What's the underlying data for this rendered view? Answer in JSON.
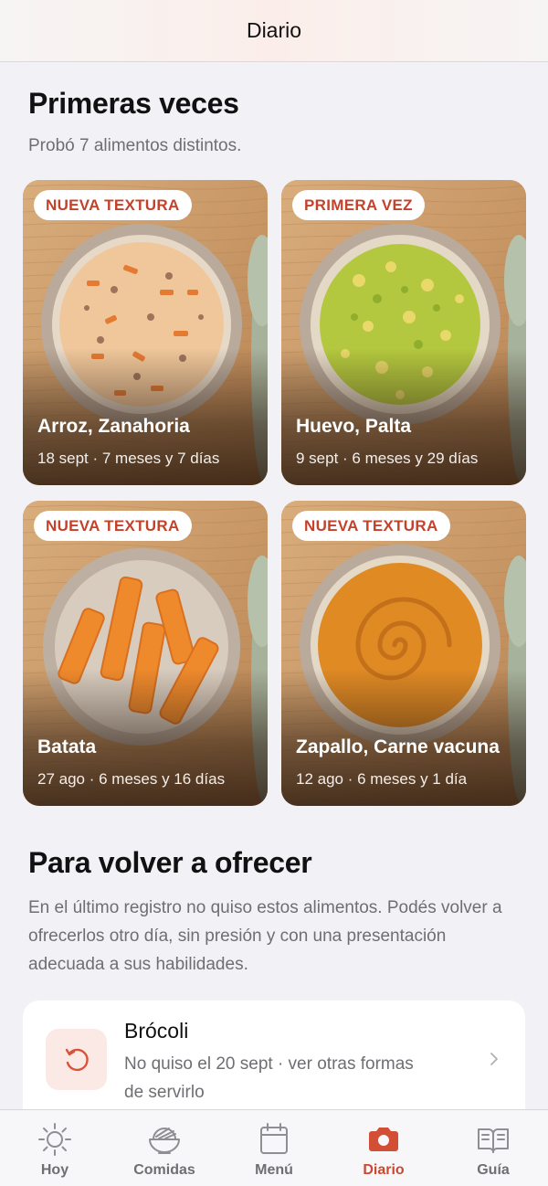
{
  "header": {
    "title": "Diario"
  },
  "firsts": {
    "title": "Primeras veces",
    "subtitle": "Probó 7 alimentos distintos.",
    "cards": [
      {
        "badge": "NUEVA TEXTURA",
        "name": "Arroz, Zanahoria",
        "meta": "18 sept · 7 meses y 7 días",
        "image": "rice-carrot-bowl"
      },
      {
        "badge": "PRIMERA VEZ",
        "name": "Huevo, Palta",
        "meta": "9 sept · 6 meses y 29 días",
        "image": "egg-avocado-bowl"
      },
      {
        "badge": "NUEVA TEXTURA",
        "name": "Batata",
        "meta": "27 ago · 6 meses y 16 días",
        "image": "sweet-potato-sticks-plate"
      },
      {
        "badge": "NUEVA TEXTURA",
        "name": "Zapallo, Carne vacuna",
        "meta": "12 ago · 6 meses y 1 día",
        "image": "pumpkin-beef-puree-bowl"
      }
    ]
  },
  "reoffer": {
    "title": "Para volver a ofrecer",
    "description": "En el último registro no quiso estos alimentos. Podés volver a ofrecerlos otro día, sin presión y con una presentación adecuada a sus habilidades.",
    "items": [
      {
        "name": "Brócoli",
        "detail": "No quiso el 20 sept · ver otras formas de servirlo",
        "icon": "retry-icon"
      }
    ]
  },
  "tabs": [
    {
      "label": "Hoy",
      "icon": "sun-icon",
      "active": false
    },
    {
      "label": "Comidas",
      "icon": "bowl-icon",
      "active": false
    },
    {
      "label": "Menú",
      "icon": "calendar-icon",
      "active": false
    },
    {
      "label": "Diario",
      "icon": "camera-icon",
      "active": true
    },
    {
      "label": "Guía",
      "icon": "book-icon",
      "active": false
    }
  ],
  "colors": {
    "accent": "#c94a33",
    "badge_text": "#c4422a",
    "background": "#f2f2f6"
  }
}
